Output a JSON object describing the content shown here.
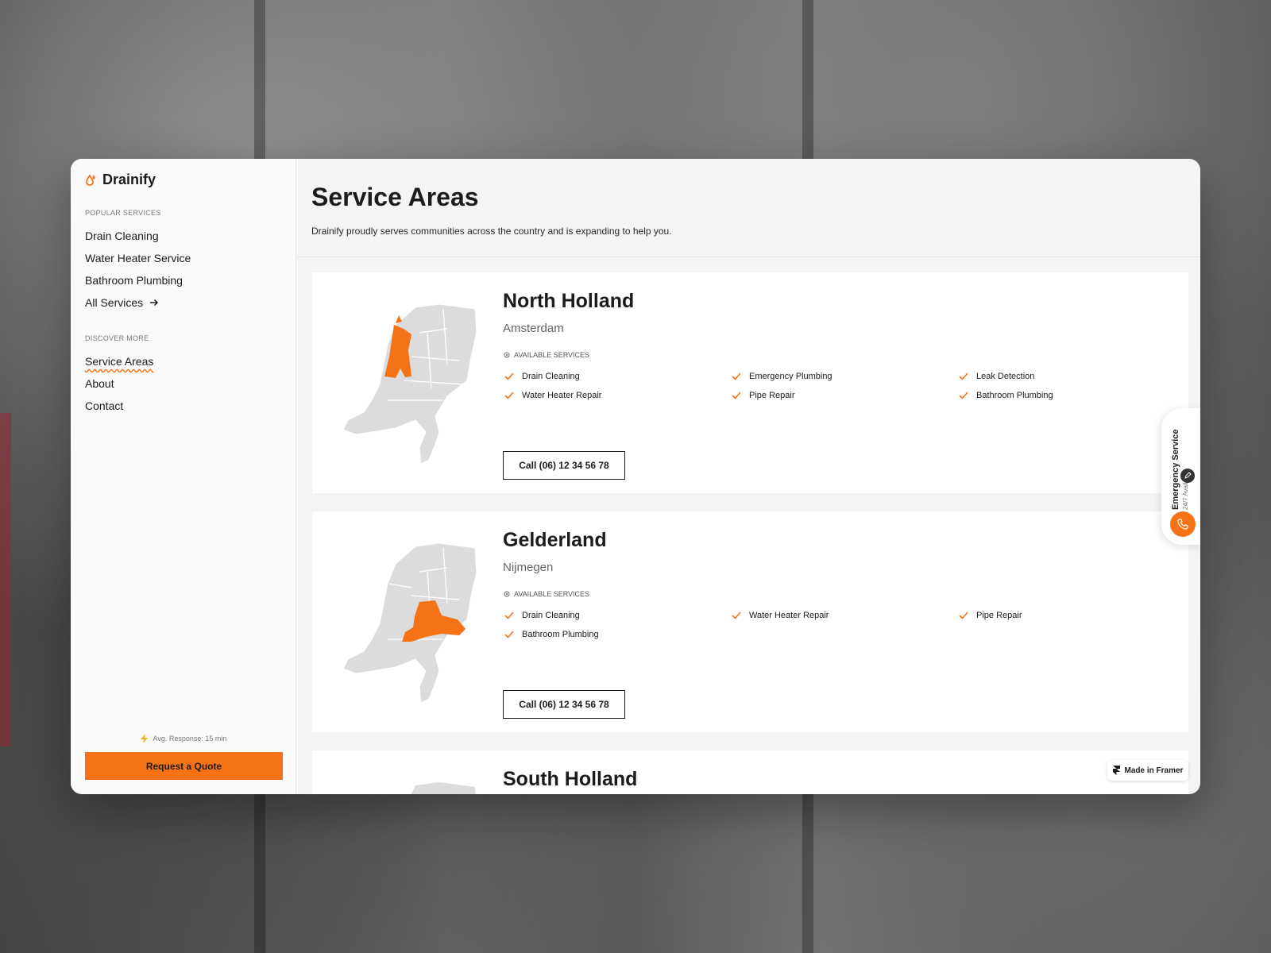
{
  "brand": {
    "name": "Drainify"
  },
  "sidebar": {
    "popular_label": "POPULAR SERVICES",
    "popular": [
      "Drain Cleaning",
      "Water Heater Service",
      "Bathroom Plumbing"
    ],
    "all_services": "All Services",
    "discover_label": "DISCOVER MORE",
    "discover": [
      "Service Areas",
      "About",
      "Contact"
    ],
    "active": "Service Areas",
    "avg_response": "Avg. Response: 15 min",
    "quote_button": "Request a Quote"
  },
  "page": {
    "title": "Service Areas",
    "subtitle": "Drainify proudly serves communities across the country and is expanding to help you."
  },
  "services_label": "AVAILABLE SERVICES",
  "cards": [
    {
      "region": "North Holland",
      "city": "Amsterdam",
      "services": [
        "Drain Cleaning",
        "Emergency Plumbing",
        "Leak Detection",
        "Water Heater Repair",
        "Pipe Repair",
        "Bathroom Plumbing"
      ],
      "call": "Call (06) 12 34 56 78",
      "highlight": "north-holland"
    },
    {
      "region": "Gelderland",
      "city": "Nijmegen",
      "services": [
        "Drain Cleaning",
        "Water Heater Repair",
        "Pipe Repair",
        "Bathroom Plumbing"
      ],
      "call": "Call (06) 12 34 56 78",
      "highlight": "gelderland"
    },
    {
      "region": "South Holland"
    }
  ],
  "emergency": {
    "title": "Emergency Service",
    "subtitle": "24/7 Available"
  },
  "framer": {
    "label": "Made in Framer"
  },
  "colors": {
    "accent": "#f57316",
    "map_gray": "#dcdcdc",
    "text": "#1c1c1c"
  },
  "icons": [
    "drop-icon",
    "arrow-right-icon",
    "lightning-icon",
    "check-icon",
    "gear-icon",
    "phone-icon",
    "edit-icon",
    "framer-icon"
  ]
}
